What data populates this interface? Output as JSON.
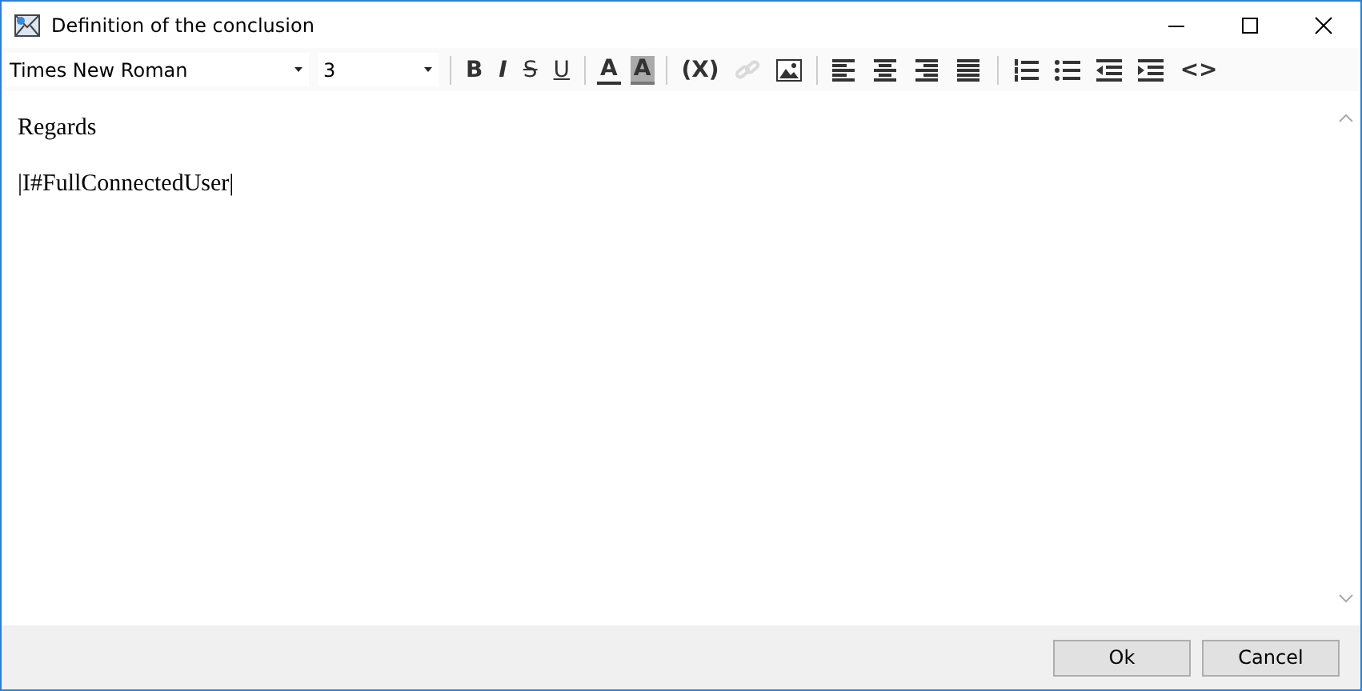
{
  "window": {
    "title": "Definition of the conclusion"
  },
  "toolbar": {
    "font": "Times New Roman",
    "size": "3",
    "items": [
      {
        "kind": "separator"
      },
      {
        "kind": "bold",
        "label": "B",
        "disabled": false
      },
      {
        "kind": "italic",
        "label": "I",
        "disabled": false
      },
      {
        "kind": "strike",
        "label": "S",
        "disabled": false
      },
      {
        "kind": "underline",
        "label": "U",
        "disabled": false
      },
      {
        "kind": "separator"
      },
      {
        "kind": "fontcolor",
        "label": "A",
        "disabled": false
      },
      {
        "kind": "highlight",
        "label": "A",
        "disabled": false
      },
      {
        "kind": "separator"
      },
      {
        "kind": "variable",
        "label": "(X)",
        "disabled": false
      },
      {
        "kind": "link",
        "disabled": true
      },
      {
        "kind": "image",
        "disabled": false
      },
      {
        "kind": "separator"
      },
      {
        "kind": "alignleft",
        "disabled": false
      },
      {
        "kind": "aligncenter",
        "disabled": false
      },
      {
        "kind": "alignright",
        "disabled": false
      },
      {
        "kind": "justify",
        "disabled": false
      },
      {
        "kind": "separator"
      },
      {
        "kind": "numbered",
        "disabled": false
      },
      {
        "kind": "bullets",
        "disabled": false
      },
      {
        "kind": "outdent",
        "disabled": false
      },
      {
        "kind": "indent",
        "disabled": false
      },
      {
        "kind": "source",
        "label": "<>",
        "disabled": false
      }
    ]
  },
  "editor": {
    "paragraphs": [
      "Regards",
      "|I#FullConnectedUser|"
    ]
  },
  "buttons": [
    "Ok",
    "Cancel"
  ]
}
